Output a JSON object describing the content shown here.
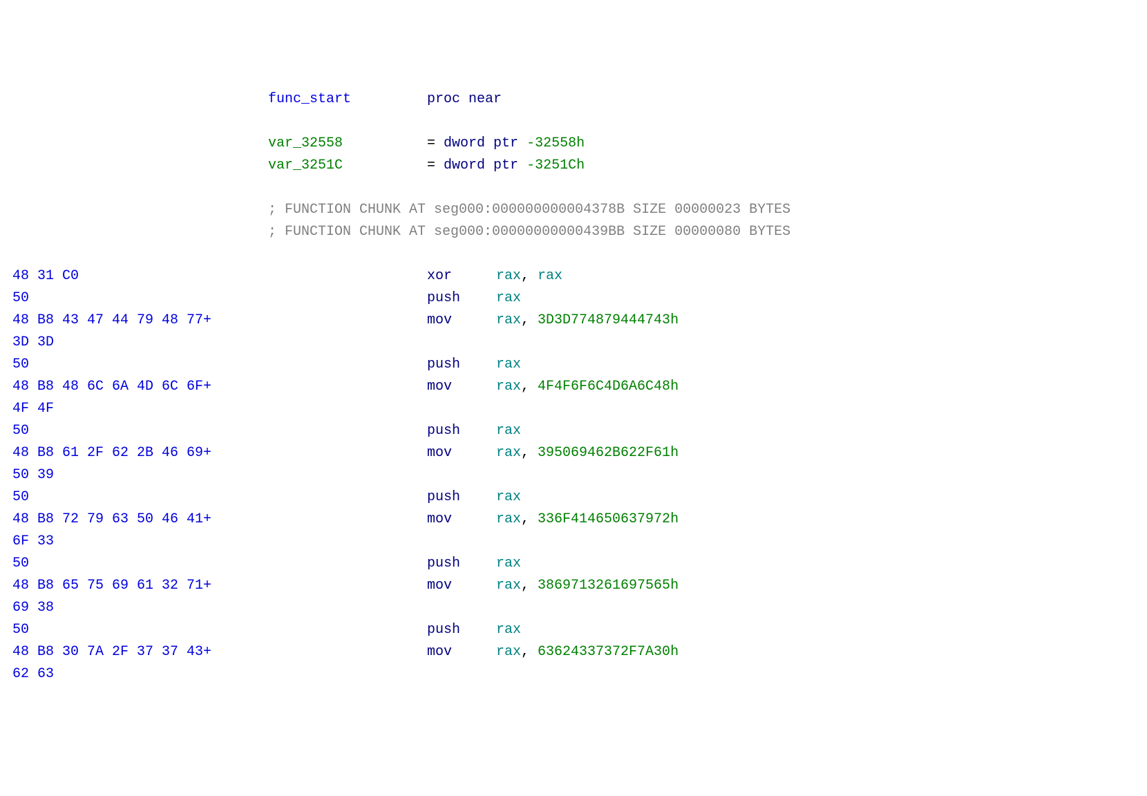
{
  "header": {
    "func_label": "func_start",
    "proc_near": "proc near",
    "var1_name": "var_32558",
    "var1_eq": "= ",
    "var1_dword": "dword",
    "var1_ptr": "ptr",
    "var1_offset": " -32558h",
    "var2_name": "var_3251C",
    "var2_eq": "= ",
    "var2_dword": "dword",
    "var2_ptr": "ptr",
    "var2_offset": " -3251Ch",
    "chunk1": "; FUNCTION CHUNK AT seg000:000000000004378B SIZE 00000023 BYTES",
    "chunk2": "; FUNCTION CHUNK AT seg000:00000000000439BB SIZE 00000080 BYTES"
  },
  "lines": [
    {
      "hex": "48 31 C0",
      "mnemonic": "xor",
      "op1": "rax",
      "comma": ", ",
      "op2": "rax",
      "op2class": "teal"
    },
    {
      "hex": "50",
      "mnemonic": "push",
      "op1": "rax"
    },
    {
      "hex": "48 B8 43 47 44 79 48 77+",
      "mnemonic": "mov",
      "op1": "rax",
      "comma": ", ",
      "op2": "3D3D774879444743h",
      "op2class": "green"
    },
    {
      "hex": "3D 3D"
    },
    {
      "hex": "50",
      "mnemonic": "push",
      "op1": "rax"
    },
    {
      "hex": "48 B8 48 6C 6A 4D 6C 6F+",
      "mnemonic": "mov",
      "op1": "rax",
      "comma": ", ",
      "op2": "4F4F6F6C4D6A6C48h",
      "op2class": "green"
    },
    {
      "hex": "4F 4F"
    },
    {
      "hex": "50",
      "mnemonic": "push",
      "op1": "rax"
    },
    {
      "hex": "48 B8 61 2F 62 2B 46 69+",
      "mnemonic": "mov",
      "op1": "rax",
      "comma": ", ",
      "op2": "395069462B622F61h",
      "op2class": "green"
    },
    {
      "hex": "50 39"
    },
    {
      "hex": "50",
      "mnemonic": "push",
      "op1": "rax"
    },
    {
      "hex": "48 B8 72 79 63 50 46 41+",
      "mnemonic": "mov",
      "op1": "rax",
      "comma": ", ",
      "op2": "336F414650637972h",
      "op2class": "green"
    },
    {
      "hex": "6F 33"
    },
    {
      "hex": "50",
      "mnemonic": "push",
      "op1": "rax"
    },
    {
      "hex": "48 B8 65 75 69 61 32 71+",
      "mnemonic": "mov",
      "op1": "rax",
      "comma": ", ",
      "op2": "3869713261697565h",
      "op2class": "green"
    },
    {
      "hex": "69 38"
    },
    {
      "hex": "50",
      "mnemonic": "push",
      "op1": "rax"
    },
    {
      "hex": "48 B8 30 7A 2F 37 37 43+",
      "mnemonic": "mov",
      "op1": "rax",
      "comma": ", ",
      "op2": "63624337372F7A30h",
      "op2class": "green"
    },
    {
      "hex": "62 63"
    }
  ]
}
